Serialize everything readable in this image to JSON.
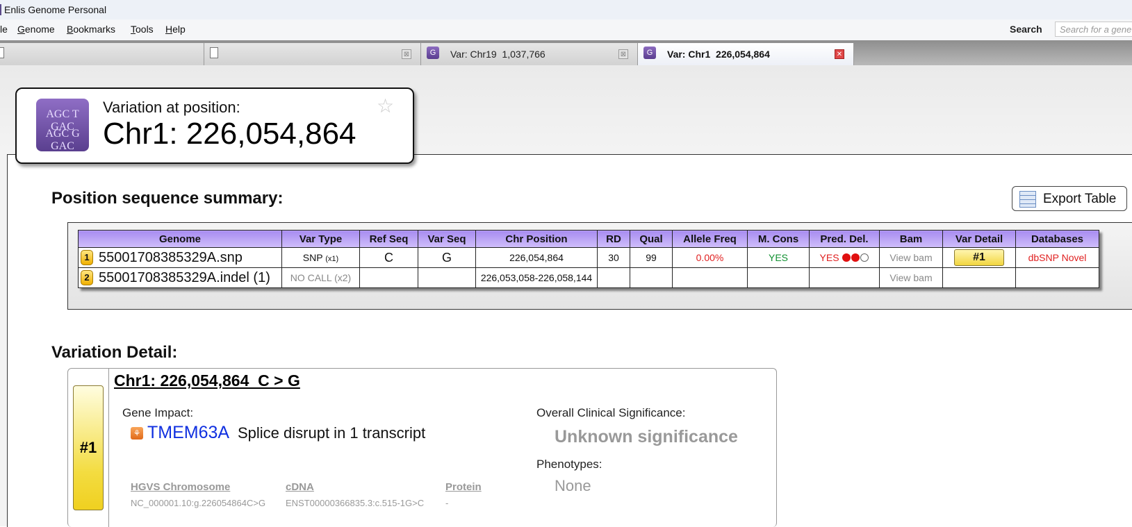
{
  "window": {
    "title": "Enlis Genome Personal"
  },
  "menu": {
    "items": [
      "le",
      "Genome",
      "Bookmarks",
      "Tools",
      "Help"
    ],
    "search_label": "Search",
    "search_placeholder": "Search for a gene"
  },
  "tabs": [
    {
      "label": ""
    },
    {
      "label": ""
    },
    {
      "label": "Var: Chr19  1,037,766"
    },
    {
      "label": "Var: Chr1  226,054,864",
      "active": true
    }
  ],
  "header": {
    "subtitle": "Variation at position:",
    "position": "Chr1: 226,054,864",
    "logo_top": "AGC T GAC",
    "logo_bottom": "AGC G GAC"
  },
  "summary": {
    "title": "Position sequence summary:",
    "export_label": "Export Table",
    "columns": [
      "Genome",
      "Var Type",
      "Ref Seq",
      "Var Seq",
      "Chr Position",
      "RD",
      "Qual",
      "Allele Freq",
      "M. Cons",
      "Pred. Del.",
      "Bam",
      "Var Detail",
      "Databases"
    ],
    "rows": [
      {
        "num": "1",
        "genome": "55001708385329A.snp",
        "var_type": "SNP",
        "var_type_count": "(x1)",
        "ref": "C",
        "var": "G",
        "chr_pos": "226,054,864",
        "rd": "30",
        "qual": "99",
        "allele_freq": "0.00%",
        "m_cons": "YES",
        "pred_del": "YES",
        "pred_del_score": 2,
        "bam": "View bam",
        "var_detail": "#1",
        "databases": "dbSNP Novel"
      },
      {
        "num": "2",
        "genome": "55001708385329A.indel (1)",
        "var_type": "NO CALL",
        "var_type_count": "(x2)",
        "ref": "",
        "var": "",
        "chr_pos": "226,053,058-226,058,144",
        "rd": "",
        "qual": "",
        "allele_freq": "",
        "m_cons": "",
        "pred_del": "",
        "bam": "View bam",
        "var_detail": "",
        "databases": ""
      }
    ]
  },
  "detail": {
    "title": "Variation Detail:",
    "tab_label": "#1",
    "heading": "Chr1: 226,054,864  C > G",
    "gene_impact_label": "Gene Impact:",
    "gene": "TMEM63A",
    "impact": "Splice disrupt in 1 transcript",
    "clinical_label": "Overall Clinical Significance:",
    "clinical_value": "Unknown significance",
    "phenotypes_label": "Phenotypes:",
    "phenotypes_value": "None",
    "hgvs": [
      {
        "header": "HGVS Chromosome",
        "value": "NC_000001.10:g.226054864C>G"
      },
      {
        "header": "cDNA",
        "value": "ENST00000366835.3:c.515-1G>C"
      },
      {
        "header": "Protein",
        "value": "-"
      }
    ]
  },
  "colors": {
    "table_header": "#a78bf0",
    "gene_link": "#1030e0",
    "alert_red": "#e02020",
    "ok_green": "#109030",
    "badge_yellow": "#f3dc40"
  }
}
